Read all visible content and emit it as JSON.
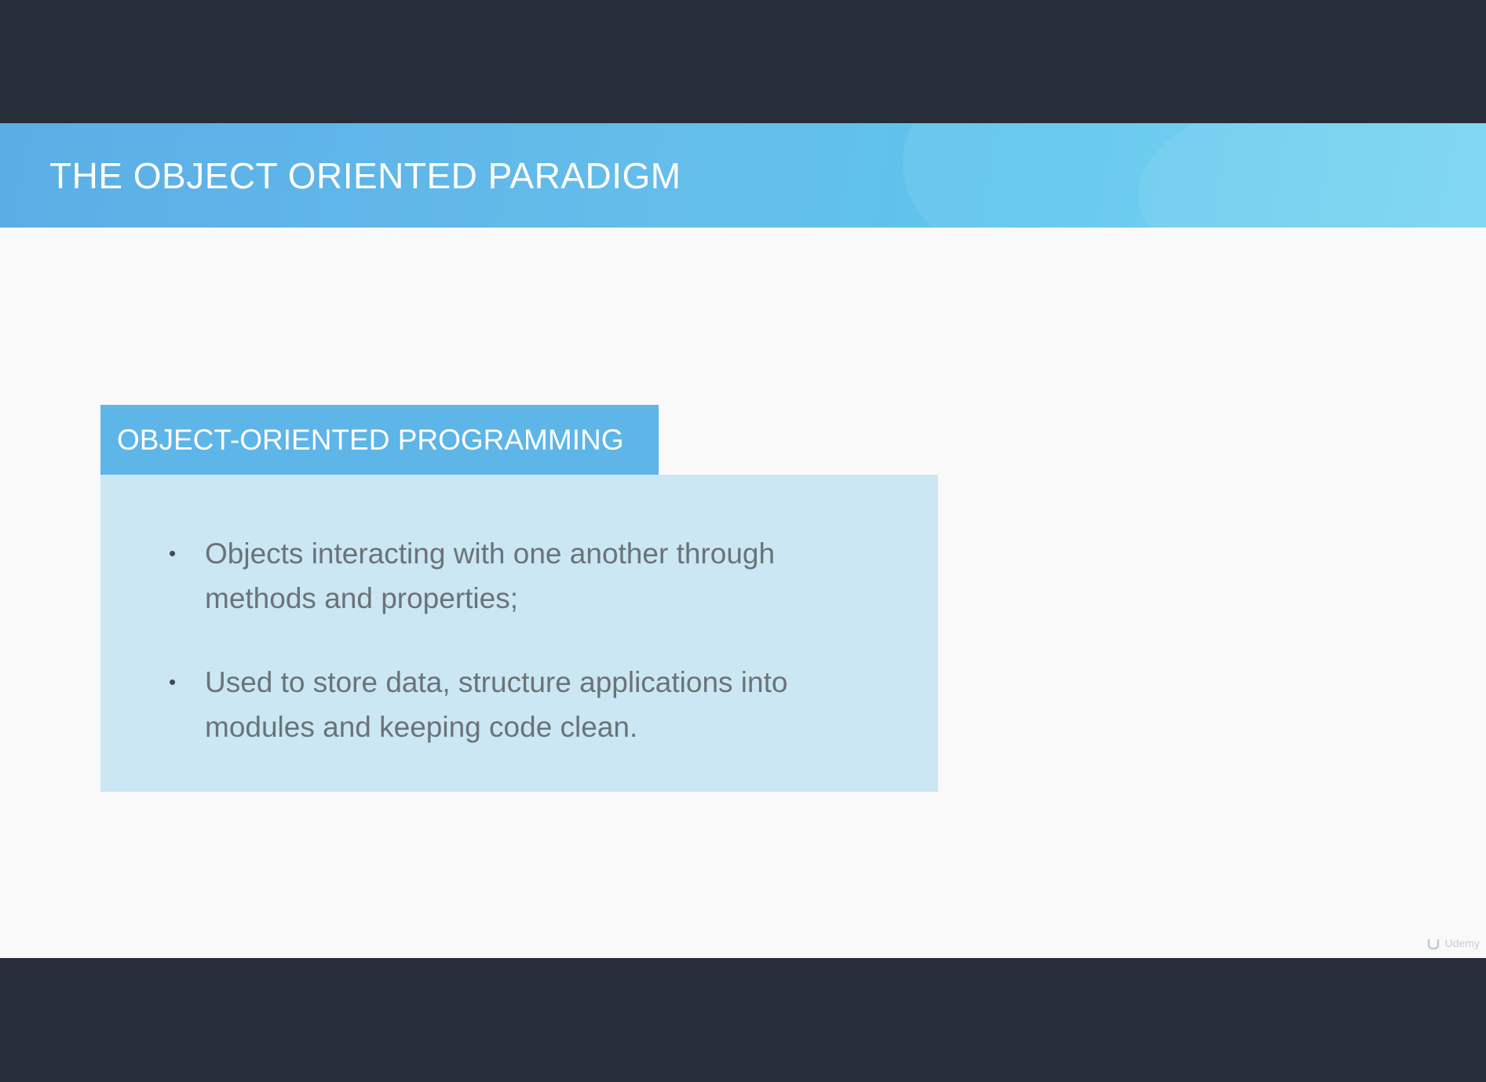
{
  "slide": {
    "title": "THE OBJECT ORIENTED PARADIGM",
    "box": {
      "heading": "OBJECT-ORIENTED PROGRAMMING",
      "bullets": [
        {
          "marker": "•",
          "text": "Objects interacting with one another through methods and properties;"
        },
        {
          "marker": "•",
          "text": "Used to store data, structure applications into modules and keeping code clean."
        }
      ]
    },
    "watermark": {
      "text": "Udemy",
      "icon": "udemy-logo-icon"
    }
  },
  "colors": {
    "letterbox": "#282d3a",
    "slide_background": "#f9f9f9",
    "header_band": "#62bde9",
    "box_tab": "#5eb5e8",
    "box_body": "#cbe7f4",
    "bullet_text": "#6b7378"
  }
}
